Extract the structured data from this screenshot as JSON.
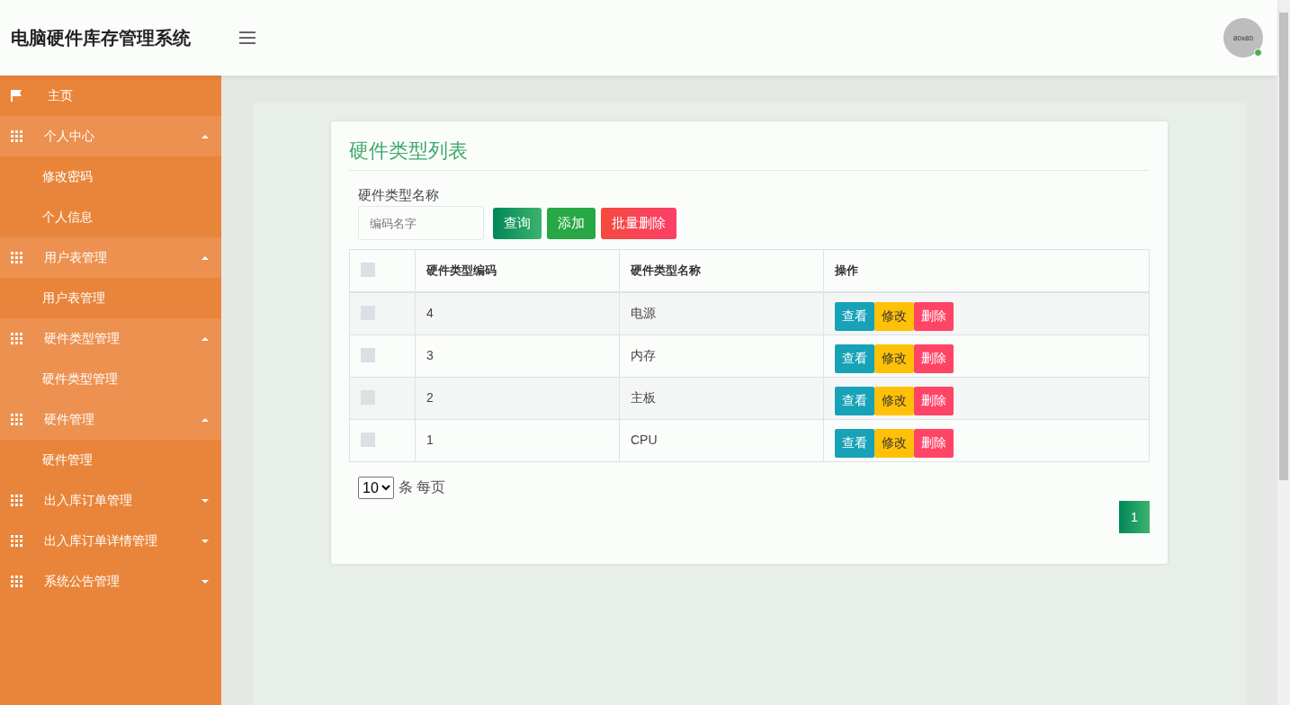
{
  "header": {
    "title": "电脑硬件库存管理系统",
    "avatar_text": "80x80",
    "online": true
  },
  "sidebar": {
    "items": [
      {
        "kind": "link",
        "label": "主页",
        "selected": false
      },
      {
        "kind": "group",
        "label": "个人中心",
        "expanded": true,
        "children": [
          {
            "label": "修改密码",
            "selected": false
          },
          {
            "label": "个人信息",
            "selected": false
          }
        ]
      },
      {
        "kind": "group",
        "label": "用户表管理",
        "expanded": true,
        "children": [
          {
            "label": "用户表管理",
            "selected": false
          }
        ]
      },
      {
        "kind": "group",
        "label": "硬件类型管理",
        "expanded": true,
        "children": [
          {
            "label": "硬件类型管理",
            "selected": true
          }
        ]
      },
      {
        "kind": "group",
        "label": "硬件管理",
        "expanded": true,
        "children": [
          {
            "label": "硬件管理",
            "selected": false
          }
        ]
      },
      {
        "kind": "group",
        "label": "出入库订单管理",
        "expanded": false
      },
      {
        "kind": "group",
        "label": "出入库订单详情管理",
        "expanded": false
      },
      {
        "kind": "group",
        "label": "系统公告管理",
        "expanded": false
      }
    ]
  },
  "card": {
    "title": "硬件类型列表",
    "search": {
      "label": "硬件类型名称",
      "placeholder": "编码名字"
    },
    "buttons": [
      {
        "kind": "query",
        "label": "查询"
      },
      {
        "kind": "add",
        "label": "添加"
      },
      {
        "kind": "delete",
        "label": "批量删除"
      }
    ],
    "table": {
      "all_checked": false,
      "columns": [
        "硬件类型编码",
        "硬件类型名称",
        "操作"
      ],
      "rows": [
        {
          "checked": false,
          "code": "4",
          "name": "电源",
          "actions": [
            "查看",
            "修改",
            "删除"
          ]
        },
        {
          "checked": false,
          "code": "3",
          "name": "内存",
          "actions": [
            "查看",
            "修改",
            "删除"
          ]
        },
        {
          "checked": false,
          "code": "2",
          "name": "主板",
          "actions": [
            "查看",
            "修改",
            "删除"
          ]
        },
        {
          "checked": false,
          "code": "1",
          "name": "CPU",
          "actions": [
            "查看",
            "修改",
            "删除"
          ]
        }
      ]
    },
    "page_size": "10",
    "page_size_label": "条 每页",
    "pages": [
      {
        "label": "1",
        "selected": true
      }
    ]
  }
}
